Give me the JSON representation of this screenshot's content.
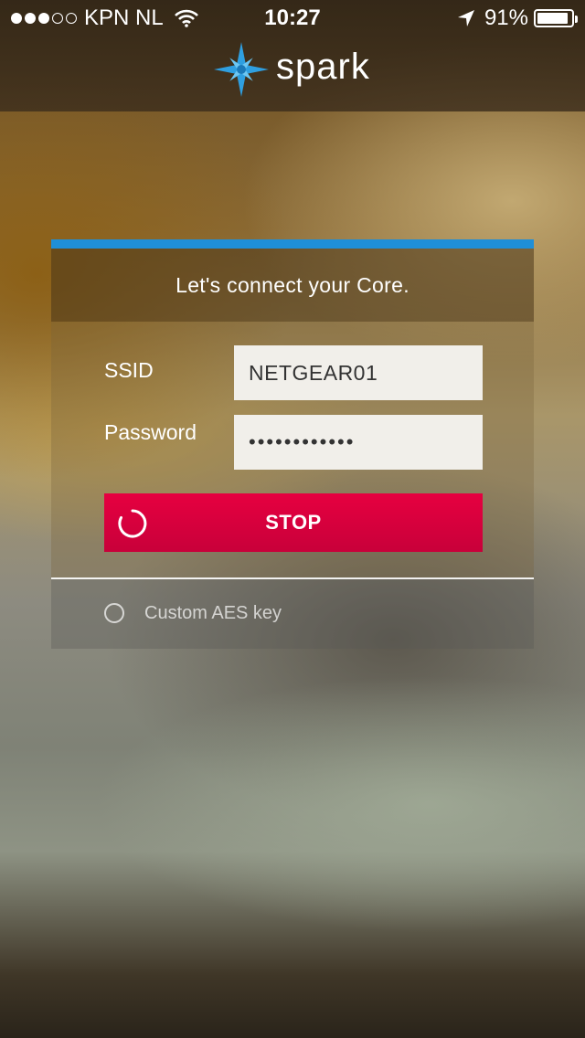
{
  "status_bar": {
    "carrier": "KPN NL",
    "time": "10:27",
    "battery": "91%",
    "battery_level": 0.91,
    "signal_bars_filled": 3,
    "signal_bars_total": 5
  },
  "header": {
    "logo_text": "spark",
    "logo_icon": "star-compass-icon"
  },
  "card": {
    "title": "Let's connect your Core.",
    "accent_color": "#1f8fd8",
    "ssid_label": "SSID",
    "ssid_value": "NETGEAR01",
    "password_label": "Password",
    "password_value": "••••••••••••",
    "stop_label": "STOP",
    "stop_color": "#e60040",
    "aes_label": "Custom AES key"
  }
}
